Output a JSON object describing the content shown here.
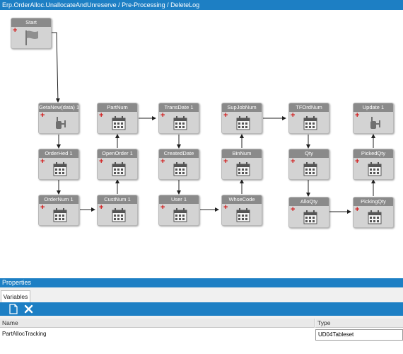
{
  "window": {
    "title": "Erp.OrderAlloc.UnallocateAndUnreserve / Pre-Processing / DeleteLog"
  },
  "workflow": {
    "nodes": {
      "start": "Start",
      "getanew": "GetaNew(data) 1",
      "orderhed": "OrderHed 1",
      "ordernum": "OrderNum 1",
      "partnum": "PartNum",
      "openorder": "OpenOrder 1",
      "custnum": "CustNum 1",
      "transdate": "TransDate 1",
      "createddate": "CreatedDate",
      "user": "User 1",
      "supjobnum": "SupJobNum",
      "binnum": "BinNum",
      "whsecode": "WhseCode",
      "tfordnum": "TFOrdNum",
      "qty": "Qty",
      "allocqty": "AlloQty",
      "update": "Update 1",
      "pickedqty": "PickedQty",
      "pickingqty": "PickingQty"
    }
  },
  "properties": {
    "title": "Properties",
    "tab": "Variables",
    "toolbar": {
      "new_icon": "new-document-icon",
      "delete_icon": "delete-x-icon"
    },
    "columns": {
      "name": "Name",
      "type": "Type"
    },
    "rows": [
      {
        "name": "PartAllocTracking",
        "type": "UD04Tableset"
      }
    ]
  }
}
